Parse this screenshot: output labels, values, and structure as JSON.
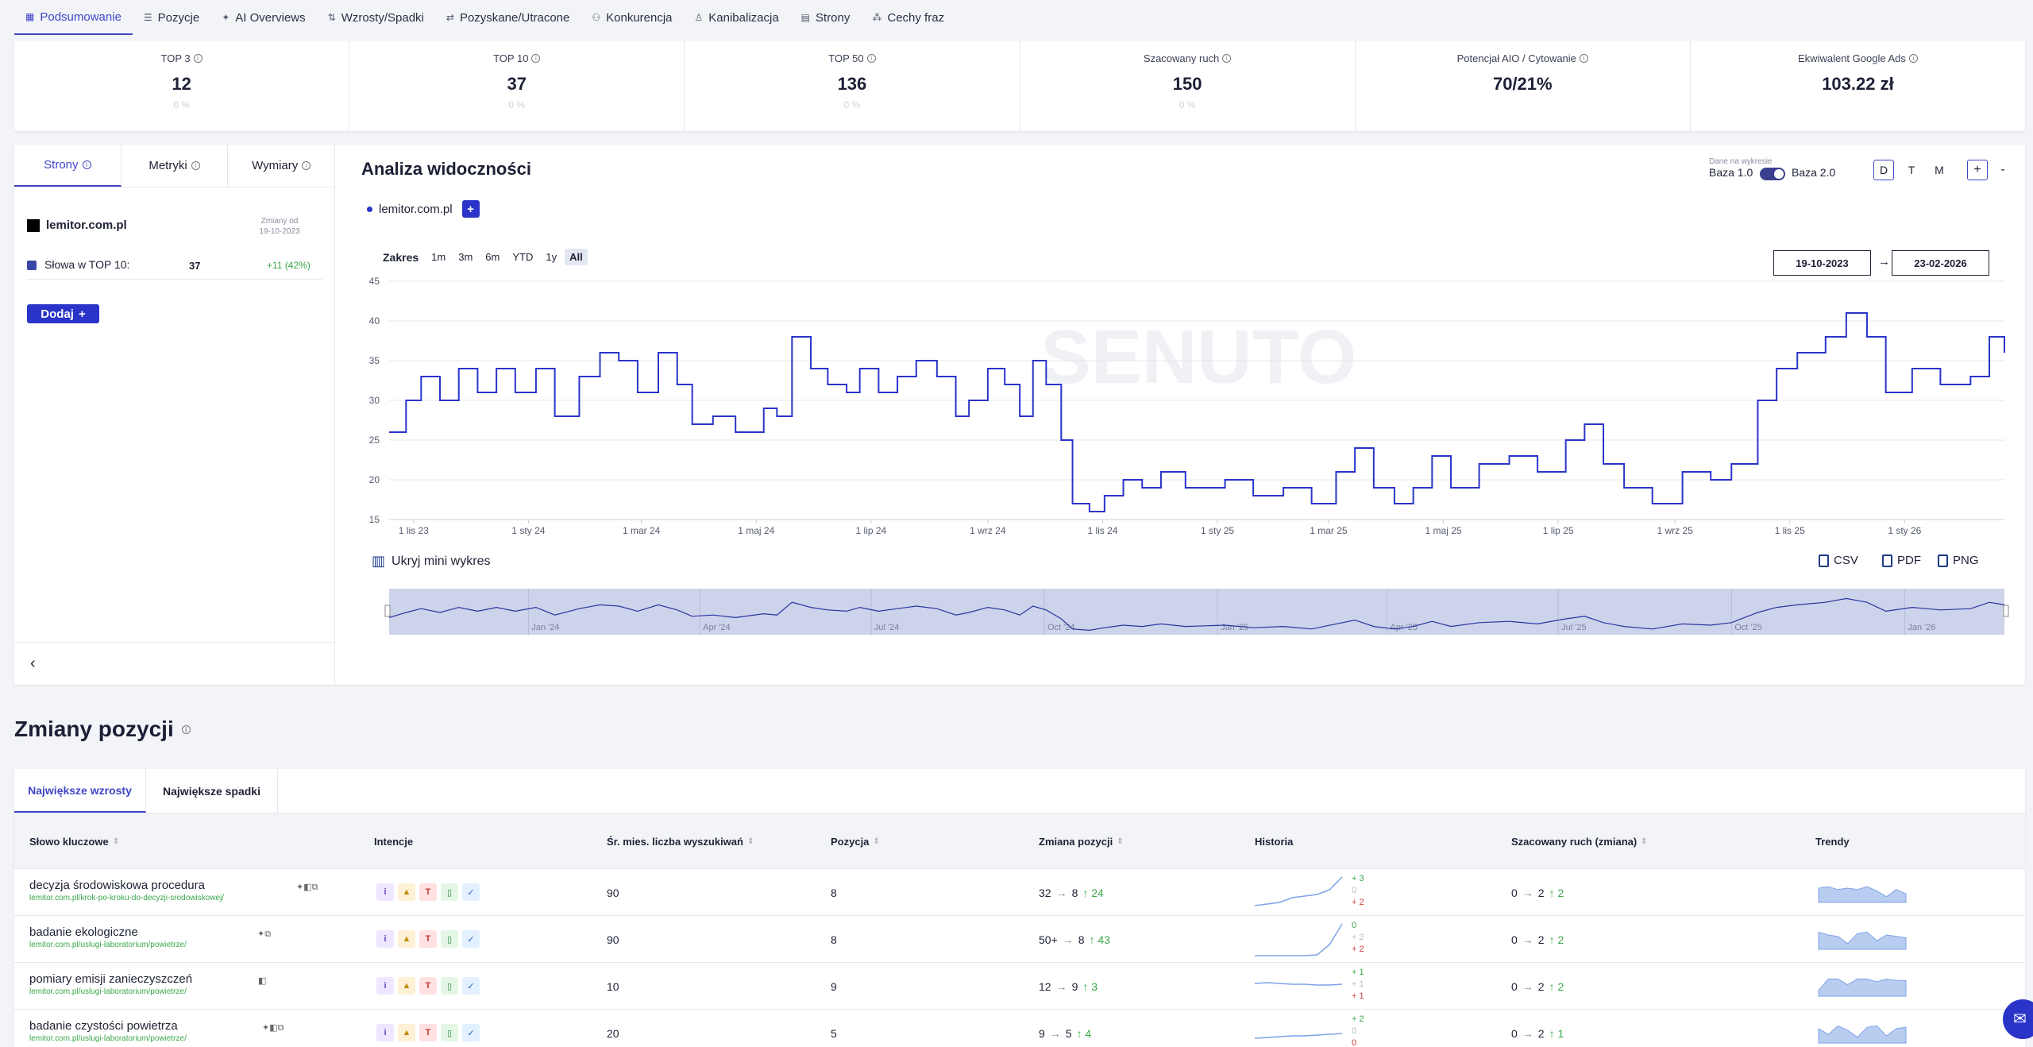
{
  "nav": {
    "tabs": [
      {
        "label": "Podsumowanie",
        "icon": "grid-icon"
      },
      {
        "label": "Pozycje",
        "icon": "list-icon"
      },
      {
        "label": "AI Overviews",
        "icon": "sparkle-icon"
      },
      {
        "label": "Wzrosty/Spadki",
        "icon": "updown-icon"
      },
      {
        "label": "Pozyskane/Utracone",
        "icon": "swap-icon"
      },
      {
        "label": "Konkurencja",
        "icon": "users-icon"
      },
      {
        "label": "Kanibalizacja",
        "icon": "person-icon"
      },
      {
        "label": "Strony",
        "icon": "pages-icon"
      },
      {
        "label": "Cechy fraz",
        "icon": "features-icon"
      }
    ]
  },
  "kpis": [
    {
      "label": "TOP 3",
      "value": "12",
      "sub": "0 %"
    },
    {
      "label": "TOP 10",
      "value": "37",
      "sub": "0 %"
    },
    {
      "label": "TOP 50",
      "value": "136",
      "sub": "0 %"
    },
    {
      "label": "Szacowany ruch",
      "value": "150",
      "sub": "0 %"
    },
    {
      "label": "Potencjał AIO / Cytowanie",
      "value": "70/21%",
      "sub": ""
    },
    {
      "label": "Ekwiwalent Google Ads",
      "value": "103.22 zł",
      "sub": ""
    }
  ],
  "left": {
    "tabs": [
      "Strony",
      "Metryki",
      "Wymiary"
    ],
    "domain": "lemitor.com.pl",
    "changes_label": "Zmiany od",
    "changes_date": "19-10-2023",
    "top10_label": "Słowa w TOP 10:",
    "top10_value": "37",
    "top10_delta": "+11 (42%)",
    "add_label": "Dodaj",
    "collapse_icon": "chevron-left-icon"
  },
  "chart_panel": {
    "title": "Analiza widoczności",
    "dane_label": "Dane na wykresie",
    "baza1": "Baza 1.0",
    "baza2": "Baza 2.0",
    "periods": [
      "D",
      "T",
      "M"
    ],
    "zoom_in": "+",
    "zoom_out": "-",
    "legend_domain": "lemitor.com.pl",
    "range_label": "Zakres",
    "ranges": [
      "1m",
      "3m",
      "6m",
      "YTD",
      "1y",
      "All"
    ],
    "date_from": "19-10-2023",
    "date_arrow": "→",
    "date_to": "23-02-2026",
    "hide_mini": "Ukryj mini wykres",
    "exports": [
      "CSV",
      "PDF",
      "PNG"
    ],
    "watermark": "SENUTO",
    "accent": "#2a34c8"
  },
  "chart_data": {
    "type": "line",
    "series": [
      {
        "name": "lemitor.com.pl",
        "points": [
          [
            "2023-10-19",
            26
          ],
          [
            "2023-10-28",
            30
          ],
          [
            "2023-11-05",
            33
          ],
          [
            "2023-11-15",
            30
          ],
          [
            "2023-11-25",
            34
          ],
          [
            "2023-12-05",
            31
          ],
          [
            "2023-12-15",
            34
          ],
          [
            "2023-12-25",
            31
          ],
          [
            "2024-01-05",
            34
          ],
          [
            "2024-01-15",
            28
          ],
          [
            "2024-01-28",
            33
          ],
          [
            "2024-02-08",
            36
          ],
          [
            "2024-02-18",
            35
          ],
          [
            "2024-02-28",
            31
          ],
          [
            "2024-03-10",
            36
          ],
          [
            "2024-03-20",
            32
          ],
          [
            "2024-03-28",
            27
          ],
          [
            "2024-04-08",
            28
          ],
          [
            "2024-04-20",
            26
          ],
          [
            "2024-05-05",
            29
          ],
          [
            "2024-05-12",
            28
          ],
          [
            "2024-05-20",
            38
          ],
          [
            "2024-05-30",
            34
          ],
          [
            "2024-06-08",
            32
          ],
          [
            "2024-06-18",
            31
          ],
          [
            "2024-06-25",
            34
          ],
          [
            "2024-07-05",
            31
          ],
          [
            "2024-07-15",
            33
          ],
          [
            "2024-07-25",
            35
          ],
          [
            "2024-08-05",
            33
          ],
          [
            "2024-08-15",
            28
          ],
          [
            "2024-08-22",
            30
          ],
          [
            "2024-09-01",
            34
          ],
          [
            "2024-09-10",
            32
          ],
          [
            "2024-09-18",
            28
          ],
          [
            "2024-09-25",
            35
          ],
          [
            "2024-10-02",
            32
          ],
          [
            "2024-10-10",
            25
          ],
          [
            "2024-10-16",
            17
          ],
          [
            "2024-10-25",
            16
          ],
          [
            "2024-11-02",
            18
          ],
          [
            "2024-11-12",
            20
          ],
          [
            "2024-11-22",
            19
          ],
          [
            "2024-12-02",
            21
          ],
          [
            "2024-12-15",
            19
          ],
          [
            "2025-01-05",
            20
          ],
          [
            "2025-01-20",
            18
          ],
          [
            "2025-02-05",
            19
          ],
          [
            "2025-02-20",
            17
          ],
          [
            "2025-03-05",
            21
          ],
          [
            "2025-03-15",
            24
          ],
          [
            "2025-03-25",
            19
          ],
          [
            "2025-04-05",
            17
          ],
          [
            "2025-04-15",
            19
          ],
          [
            "2025-04-25",
            23
          ],
          [
            "2025-05-05",
            19
          ],
          [
            "2025-05-20",
            22
          ],
          [
            "2025-06-05",
            23
          ],
          [
            "2025-06-20",
            21
          ],
          [
            "2025-07-05",
            25
          ],
          [
            "2025-07-15",
            27
          ],
          [
            "2025-07-25",
            22
          ],
          [
            "2025-08-05",
            19
          ],
          [
            "2025-08-20",
            17
          ],
          [
            "2025-09-05",
            21
          ],
          [
            "2025-09-20",
            20
          ],
          [
            "2025-10-01",
            22
          ],
          [
            "2025-10-15",
            30
          ],
          [
            "2025-10-25",
            34
          ],
          [
            "2025-11-05",
            36
          ],
          [
            "2025-11-20",
            38
          ],
          [
            "2025-12-01",
            41
          ],
          [
            "2025-12-12",
            38
          ],
          [
            "2025-12-22",
            31
          ],
          [
            "2026-01-05",
            34
          ],
          [
            "2026-01-20",
            32
          ],
          [
            "2026-02-05",
            33
          ],
          [
            "2026-02-15",
            38
          ],
          [
            "2026-02-23",
            36
          ]
        ]
      }
    ],
    "xlim": [
      "2023-10-19",
      "2026-02-23"
    ],
    "ylim": [
      15,
      45
    ],
    "yticks": [
      15,
      20,
      25,
      30,
      35,
      40,
      45
    ],
    "xticks": [
      {
        "date": "2023-11-01",
        "label": "1 lis 23"
      },
      {
        "date": "2024-01-01",
        "label": "1 sty 24"
      },
      {
        "date": "2024-03-01",
        "label": "1 mar 24"
      },
      {
        "date": "2024-05-01",
        "label": "1 maj 24"
      },
      {
        "date": "2024-07-01",
        "label": "1 lip 24"
      },
      {
        "date": "2024-09-01",
        "label": "1 wrz 24"
      },
      {
        "date": "2024-11-01",
        "label": "1 lis 24"
      },
      {
        "date": "2025-01-01",
        "label": "1 sty 25"
      },
      {
        "date": "2025-03-01",
        "label": "1 mar 25"
      },
      {
        "date": "2025-05-01",
        "label": "1 maj 25"
      },
      {
        "date": "2025-07-01",
        "label": "1 lip 25"
      },
      {
        "date": "2025-09-01",
        "label": "1 wrz 25"
      },
      {
        "date": "2025-11-01",
        "label": "1 lis 25"
      },
      {
        "date": "2026-01-01",
        "label": "1 sty 26"
      }
    ],
    "navigator_ticks": [
      {
        "date": "2024-01-01",
        "label": "Jan '24"
      },
      {
        "date": "2024-04-01",
        "label": "Apr '24"
      },
      {
        "date": "2024-07-01",
        "label": "Jul '24"
      },
      {
        "date": "2024-10-01",
        "label": "Oct '24"
      },
      {
        "date": "2025-01-01",
        "label": "Jan '25"
      },
      {
        "date": "2025-04-01",
        "label": "Apr '25"
      },
      {
        "date": "2025-07-01",
        "label": "Jul '25"
      },
      {
        "date": "2025-10-01",
        "label": "Oct '25"
      },
      {
        "date": "2026-01-01",
        "label": "Jan '26"
      }
    ],
    "grid": true,
    "legend": "top-left"
  },
  "changes": {
    "title": "Zmiany pozycji",
    "tabs": [
      "Największe wzrosty",
      "Największe spadki"
    ],
    "columns": [
      "Słowo kluczowe",
      "Intencje",
      "Śr. mies. liczba wyszukiwań",
      "Pozycja",
      "Zmiana pozycji",
      "Historia",
      "Szacowany ruch (zmiana)",
      "Trendy"
    ],
    "intent_letters": [
      "i",
      "▲",
      "T",
      "▯",
      "✓"
    ],
    "rows": [
      {
        "keyword": "decyzja środowiskowa procedura",
        "url": "lemitor.com.pl/krok-po-kroku-do-decyzji-srodowiskowej/",
        "icons": "✦◧⧉",
        "volume": "90",
        "position": "8",
        "change_from": "32",
        "change_to": "8",
        "change_delta": "↑ 24",
        "hist": [
          "+ 3",
          "0",
          "+ 2"
        ],
        "hist_spark": [
          40,
          38,
          36,
          30,
          28,
          26,
          20,
          4
        ],
        "traffic_from": "0",
        "traffic_to": "2",
        "traffic_delta": "↑ 2",
        "trend_spark": [
          10,
          11,
          9,
          10,
          9,
          11,
          8,
          4,
          9,
          6
        ]
      },
      {
        "keyword": "badanie ekologiczne",
        "url": "lemitor.com.pl/uslugi-laboratorium/powietrze/",
        "icons": "✦⧉",
        "volume": "90",
        "position": "8",
        "change_from": "50+",
        "change_to": "8",
        "change_delta": "↑ 43",
        "hist": [
          "0",
          "+ 2",
          "+ 2"
        ],
        "hist_spark": [
          44,
          44,
          44,
          44,
          44,
          43,
          30,
          4
        ],
        "traffic_from": "0",
        "traffic_to": "2",
        "traffic_delta": "↑ 2",
        "trend_spark": [
          12,
          10,
          9,
          4,
          11,
          12,
          6,
          10,
          9,
          8
        ]
      },
      {
        "keyword": "pomiary emisji zanieczyszczeń",
        "url": "lemitor.com.pl/uslugi-laboratorium/powietrze/",
        "icons": "◧",
        "volume": "10",
        "position": "9",
        "change_from": "12",
        "change_to": "9",
        "change_delta": "↑ 3",
        "hist": [
          "+ 1",
          "+ 1",
          "+ 1"
        ],
        "hist_spark": [
          20,
          19,
          20,
          21,
          21,
          22,
          22,
          21
        ],
        "traffic_from": "0",
        "traffic_to": "2",
        "traffic_delta": "↑ 2",
        "trend_spark": [
          4,
          12,
          12,
          8,
          12,
          12,
          10,
          12,
          11,
          11
        ]
      },
      {
        "keyword": "badanie czystości powietrza",
        "url": "lemitor.com.pl/uslugi-laboratorium/powietrze/",
        "icons": "✦◧⧉",
        "volume": "20",
        "position": "5",
        "change_from": "9",
        "change_to": "5",
        "change_delta": "↑ 4",
        "hist": [
          "+ 2",
          "0",
          "0"
        ],
        "hist_spark": [
          30,
          29,
          28,
          27,
          27,
          26,
          25,
          24
        ],
        "traffic_from": "0",
        "traffic_to": "2",
        "traffic_delta": "↑ 1",
        "trend_spark": [
          10,
          6,
          12,
          9,
          4,
          11,
          12,
          5,
          10,
          11
        ]
      }
    ]
  }
}
